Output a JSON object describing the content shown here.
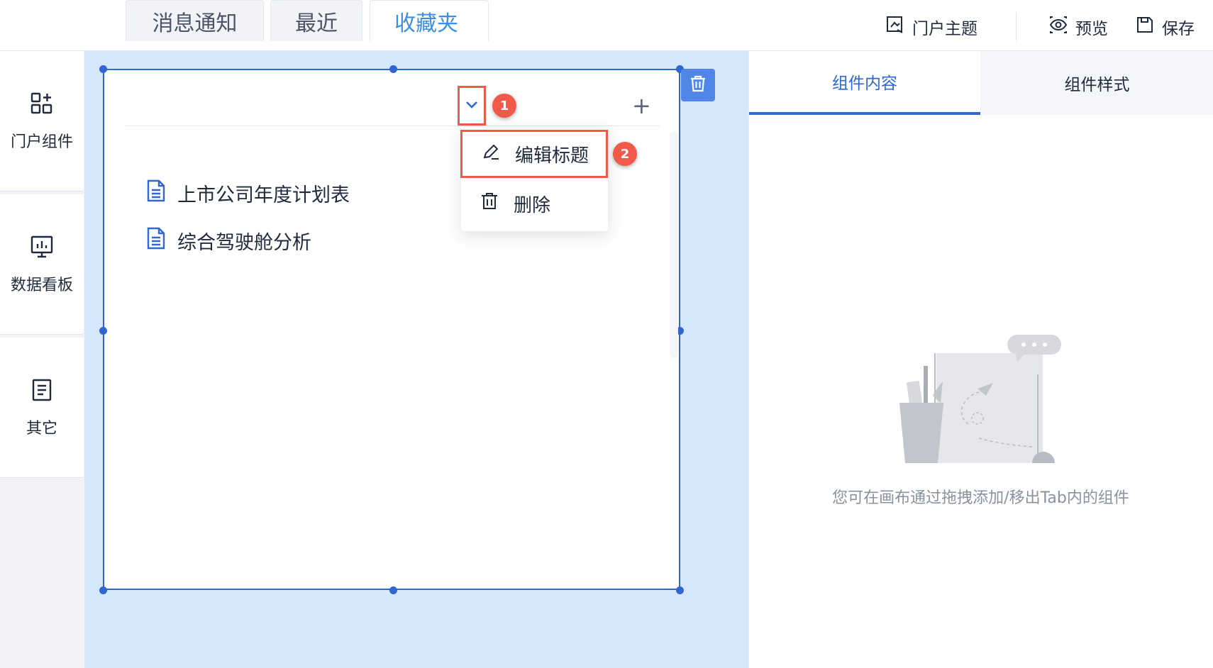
{
  "topbar": {
    "theme_label": "门户主题",
    "preview_label": "预览",
    "save_label": "保存"
  },
  "sidebar": {
    "items": [
      {
        "label": "门户组件",
        "icon": "components-icon"
      },
      {
        "label": "数据看板",
        "icon": "dashboard-icon"
      },
      {
        "label": "其它",
        "icon": "document-icon"
      }
    ]
  },
  "widget": {
    "tabs": [
      {
        "label": "消息通知",
        "active": false
      },
      {
        "label": "最近",
        "active": false
      },
      {
        "label": "收藏夹",
        "active": true
      }
    ],
    "add_tab_label": "+",
    "menu": {
      "edit_title_label": "编辑标题",
      "delete_label": "删除"
    },
    "files": [
      {
        "name": "上市公司年度计划表"
      },
      {
        "name": "综合驾驶舱分析"
      }
    ]
  },
  "annotations": {
    "step1": "1",
    "step2": "2"
  },
  "right_panel": {
    "tabs": [
      {
        "label": "组件内容",
        "active": true
      },
      {
        "label": "组件样式",
        "active": false
      }
    ],
    "empty_text": "您可在画布通过拖拽添加/移出Tab内的组件"
  },
  "colors": {
    "accent": "#2f66d1",
    "active_tab_text": "#3a8ee6",
    "canvas_bg": "#d6e6fb",
    "annotation_red": "#ef5a4a"
  }
}
